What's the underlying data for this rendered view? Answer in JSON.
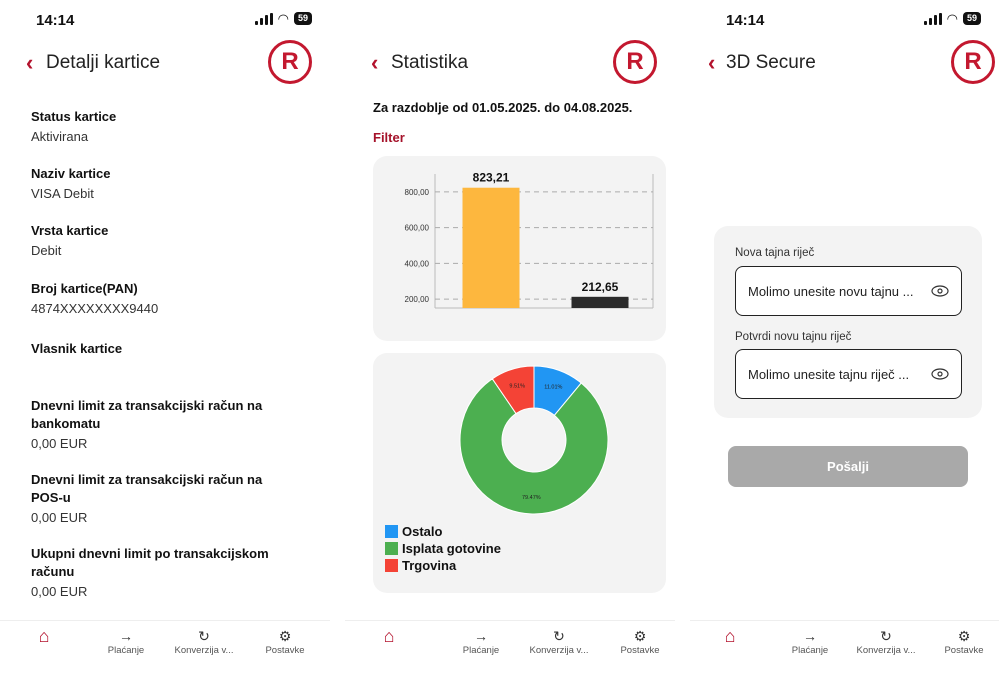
{
  "status": {
    "time": "14:14",
    "battery": "59"
  },
  "nav": {
    "payments": "Plaćanje",
    "conversion": "Konverzija v...",
    "settings": "Postavke"
  },
  "screen1": {
    "title": "Detalji kartice",
    "fields": [
      {
        "label": "Status kartice",
        "value": "Aktivirana"
      },
      {
        "label": "Naziv kartice",
        "value": "VISA Debit"
      },
      {
        "label": "Vrsta kartice",
        "value": "Debit"
      },
      {
        "label": "Broj kartice(PAN)",
        "value": "4874XXXXXXXX9440"
      },
      {
        "label": "Vlasnik kartice",
        "value": ""
      },
      {
        "label": "Dnevni limit za transakcijski račun na bankomatu",
        "value": "0,00 EUR"
      },
      {
        "label": "Dnevni limit za transakcijski račun na POS-u",
        "value": "0,00 EUR"
      },
      {
        "label": "Ukupni dnevni limit po transakcijskom računu",
        "value": "0,00 EUR"
      }
    ]
  },
  "screen2": {
    "title": "Statistika",
    "period": "Za razdoblje od 01.05.2025. do 04.08.2025.",
    "filter": "Filter"
  },
  "chart_data": [
    {
      "type": "bar",
      "categories": [
        "",
        ""
      ],
      "values": [
        823.21,
        212.65
      ],
      "value_labels": [
        "823,21",
        "212,65"
      ],
      "colors": [
        "#FDB73E",
        "#2b2b2b"
      ],
      "yticks": [
        "800,00",
        "600,00",
        "400,00",
        "200,00"
      ],
      "ytick_values": [
        800,
        600,
        400,
        200
      ],
      "ylim": [
        150,
        900
      ],
      "grid": "dashed horizontal"
    },
    {
      "type": "pie",
      "donut": true,
      "labels": [
        "Ostalo",
        "Isplata gotovine",
        "Trgovina"
      ],
      "values": [
        11.01,
        79.47,
        9.51
      ],
      "value_labels": [
        "11.01%",
        "79.47%",
        "9.51%"
      ],
      "colors": [
        "#2196F3",
        "#4CAF50",
        "#F44336"
      ],
      "legend": "bottom-left"
    }
  ],
  "screen3": {
    "title": "3D Secure",
    "new_label": "Nova tajna riječ",
    "new_placeholder": "Molimo unesite novu tajnu ...",
    "confirm_label": "Potvrdi novu tajnu riječ",
    "confirm_placeholder": "Molimo unesite tajnu riječ ...",
    "submit": "Pošalji"
  }
}
